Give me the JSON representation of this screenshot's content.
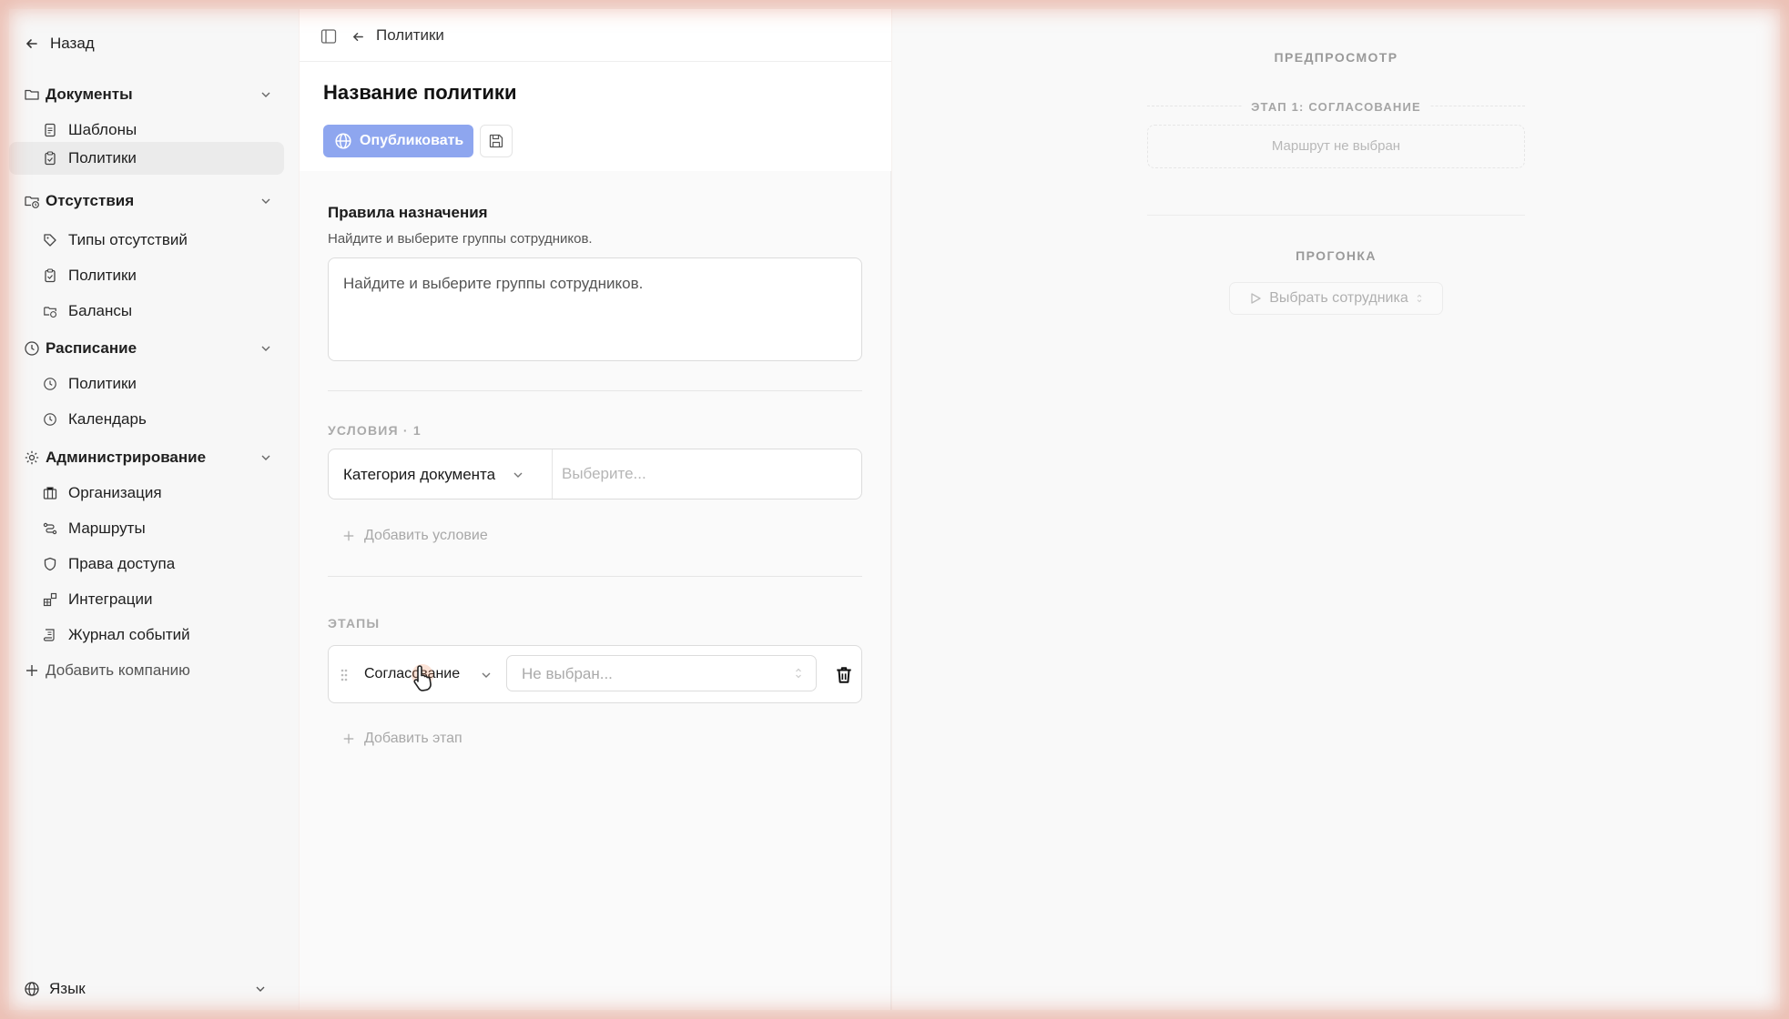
{
  "sidebar": {
    "back_label": "Назад",
    "groups": [
      {
        "label": "Документы",
        "items": [
          {
            "label": "Шаблоны"
          },
          {
            "label": "Политики"
          }
        ]
      },
      {
        "label": "Отсутствия",
        "items": [
          {
            "label": "Типы отсутствий"
          },
          {
            "label": "Политики"
          },
          {
            "label": "Балансы"
          }
        ]
      },
      {
        "label": "Расписание",
        "items": [
          {
            "label": "Политики"
          },
          {
            "label": "Календарь"
          }
        ]
      },
      {
        "label": "Администрирование",
        "items": [
          {
            "label": "Организация"
          },
          {
            "label": "Маршруты"
          },
          {
            "label": "Права доступа"
          },
          {
            "label": "Интеграции"
          },
          {
            "label": "Журнал событий"
          }
        ]
      }
    ],
    "add_company": "Добавить компанию",
    "language": "Язык"
  },
  "main": {
    "breadcrumb": "Политики",
    "title": "Название политики",
    "publish_label": "Опубликовать",
    "assignment": {
      "title": "Правила назначения",
      "description": "Найдите и выберите группы сотрудников.",
      "placeholder": "Найдите и выберите группы сотрудников."
    },
    "conditions": {
      "header": "УСЛОВИЯ · 1",
      "field": "Категория документа",
      "value_placeholder": "Выберите...",
      "add_label": "Добавить условие"
    },
    "stages": {
      "header": "ЭТАПЫ",
      "stage_type": "Согласование",
      "route_placeholder": "Не выбран...",
      "add_label": "Добавить этап"
    }
  },
  "preview": {
    "header": "ПРЕДПРОСМОТР",
    "stage_label": "ЭТАП 1: СОГЛАСОВАНИЕ",
    "route_empty": "Маршрут не выбран",
    "run_header": "ПРОГОНКА",
    "select_employee": "Выбрать сотрудника"
  },
  "colors": {
    "accent": "#8ea6ef",
    "active_nav": "#ebebeb"
  }
}
